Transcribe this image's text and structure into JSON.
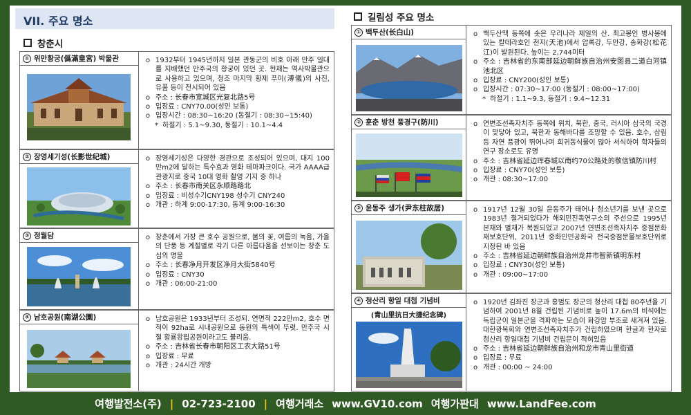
{
  "section_title": "VII. 주요 명소",
  "left_city": "창춘시",
  "right_city": "길림성 주요 명소",
  "left_cards": [
    {
      "num": "①",
      "title": "위만황궁(僞滿皇宮) 박물관",
      "items": [
        "1932부터 1945년까지 일본 관동군의 비호 아래 만주 일대를 지배했던 만주국의 황궁이 있던 곳. 현재는 역사박물관으로 사용하고 있으며, 청조 마지막 황제 푸이(溥儀)의 사진, 유품 등이 전시되어 있음",
        "주소 : 长春市宽城区光复北路5号",
        "입장료 : CNY70.00(성인 보통)",
        "입장시간 : 08:30~16:20 (동절기 : 08:30~15:40)"
      ],
      "note": "하절기 : 5.1~9.30, 동절기 : 10.1~4.4"
    },
    {
      "num": "②",
      "title": "장영세기성(长影世纪城)",
      "items": [
        "장영세기성은 다양한 경관으로 조성되어 있으며, 대지 100만m2에 달하는 특수효과 영화 테마파크이다. 국가 AAAA급 관광지로 중국 10대 영화 촬영 기지 중 하나",
        "주소 : 长春市南关区永顺路路北",
        "입장료 : 비성수기CNY198 성수기 CNY240",
        "개관 : 하계 9:00-17:30, 동계 9:00-16:30"
      ]
    },
    {
      "num": "③",
      "title": "정월담",
      "items": [
        "창춘에서 가장 큰 호수 공원으로, 봄의 꽃, 여름의 녹음, 가을의 단풍 등 계절별로 각기 다른 아름다움을 선보이는 창춘 도심의 명물",
        "주소 : 长春净月开发区净月大街5840号",
        "입장료 : CNY30",
        "개관 : 06:00-21:00"
      ]
    },
    {
      "num": "④",
      "title": "남호공원(南湖公園)",
      "items": [
        "남호공원은 1933년부터 조성되. 연면적 222만m2, 호수 면적이 92ha로 시내공원으로 동원의 특색이 뚜렷. 만주국 시절 황룡왕립공원이라고도 불리움.",
        "주소 : 吉林省长春市朝阳区工农大路51号",
        "입장료 : 무료",
        "개관 : 24시간 개방"
      ]
    }
  ],
  "right_cards": [
    {
      "num": "①",
      "title": "백두산(长白山)",
      "items": [
        "백두산맥 동쪽에 솟은 우리나라 제일의 산. 최고봉인 병사봉에 있는 칼데라호인 천지(天池)에서 압록강, 두만강, 송화강(松花江)이 발원된다. 높이는 2,744미터",
        "주소 : 吉林省的东南部延边朝鲜族自治州安图县二道白河镇池北区",
        "입장료 : CNY200(성인 보통)",
        "입장시간 : 07:30~17:00 (동절기 : 08:00~17:00)"
      ],
      "note": "하절기 : 1.1~9.3, 동절기 : 9.4~12.31"
    },
    {
      "num": "②",
      "title": "훈춘 방천 풍경구(防川)",
      "items": [
        "연변조선족자치주 동쪽에 위치, 북한, 중국, 러시아 삼국의 국경이 맞닿아 있고, 북한과 동해바다를 조망할 수 있음. 호수, 삼림 등 자연 풍광이 뛰어나며 희귀동식물이 많아 서식하여 학자들의 연구 장소로도 유명",
        "주소 : 吉林省延边珲春城以南约70公路处的敬信镇防川村",
        "입장료 : CNY70(성인 보통)",
        "개관 : 08:30~17:00"
      ]
    },
    {
      "num": "③",
      "title": "윤동주 생가(尹东柱故居)",
      "items": [
        "1917년 12월 30일 윤동주가 태어나 청소년기를 보낸 곳으로 1983년 철거되었다가 해외민진족연구소의 주선으로 1995년 본채와 별채가 복원되었고 2007년 연변조선족자치주 중점문화재보호단위, 2011년 중화인민공화국 전국중점문물보호단위로 지정된 바 있음",
        "주소 : 吉林省延边朝鲜族自治州龙井市智新镇明东村",
        "입장료 : CNY30(성인 보통)",
        "개관 : 09:00~17:00"
      ]
    },
    {
      "num": "④",
      "title": "청산리 항일 대첩 기념비",
      "subtitle": "(青山里抗日大捷纪念碑)",
      "items": [
        "1920년 김좌진 장군과 홍범도 장군의 청산리 대첩 80주년을 기념하여 2001년 8월 건립된 기념비로 높이 17.6m의 비석에는 독립군이 일본군을 격파하는 모습이 화강암 부조로 새겨져 있음. 대한광복회와 연변조선족자치주가 건립하였으며 한글과 한자로 청산리 항일대첩 기념비 건립문이 적혀있음",
        "주소 : 吉林省延边朝鲜族自治州和龙市青山里街道",
        "입장료 : 무료",
        "개관 : 00:00 ~ 24:00"
      ]
    }
  ],
  "footer": {
    "company": "여행발전소(주)",
    "phone": "02-723-2100",
    "agency_label": "여행거래소",
    "agency_url": "www.GV10.com",
    "fare_label": "여행가판대",
    "fare_url": "www.LandFee.com",
    "separator": "|"
  },
  "colors": {
    "frame": "#2f5a23",
    "header_bg": "#dde6f2",
    "header_text": "#1f3b66",
    "separator": "#f0c020"
  }
}
